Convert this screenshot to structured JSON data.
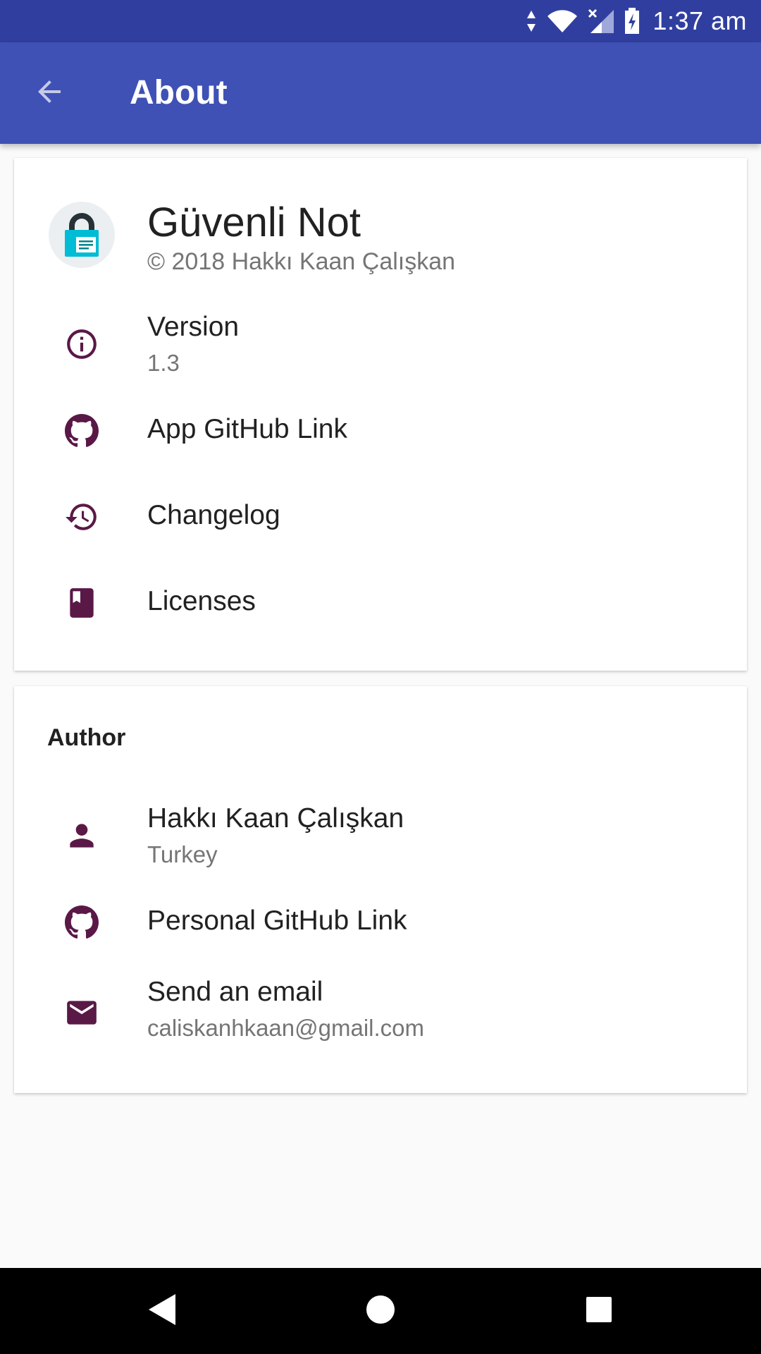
{
  "status_bar": {
    "time": "1:37 am",
    "icons": [
      "data-arrows-icon",
      "wifi-icon",
      "signal-off-icon",
      "battery-charging-icon"
    ]
  },
  "app_bar": {
    "title": "About",
    "back_icon": "arrow-back-icon",
    "background_color": "#3f51b5",
    "status_color": "#303f9f"
  },
  "app_card": {
    "app_name": "Güvenli Not",
    "copyright": "© 2018 Hakkı Kaan Çalışkan",
    "logo_icon": "lock-note-app-icon",
    "items": [
      {
        "title": "Version",
        "subtitle": "1.3",
        "icon": "info-icon"
      },
      {
        "title": "App GitHub Link",
        "icon": "github-icon"
      },
      {
        "title": "Changelog",
        "icon": "history-icon"
      },
      {
        "title": "Licenses",
        "icon": "book-icon"
      }
    ]
  },
  "author_card": {
    "header": "Author",
    "items": [
      {
        "title": "Hakkı Kaan Çalışkan",
        "subtitle": "Turkey",
        "icon": "person-icon"
      },
      {
        "title": "Personal GitHub Link",
        "icon": "github-icon"
      },
      {
        "title": "Send an email",
        "subtitle": "caliskanhkaan@gmail.com",
        "icon": "email-icon"
      }
    ]
  },
  "colors": {
    "icon_tint": "#5a1847",
    "secondary_text": "#757575",
    "primary_text": "#212121"
  },
  "nav_bar": {
    "buttons": [
      "back-triangle-icon",
      "home-circle-icon",
      "recents-square-icon"
    ]
  }
}
